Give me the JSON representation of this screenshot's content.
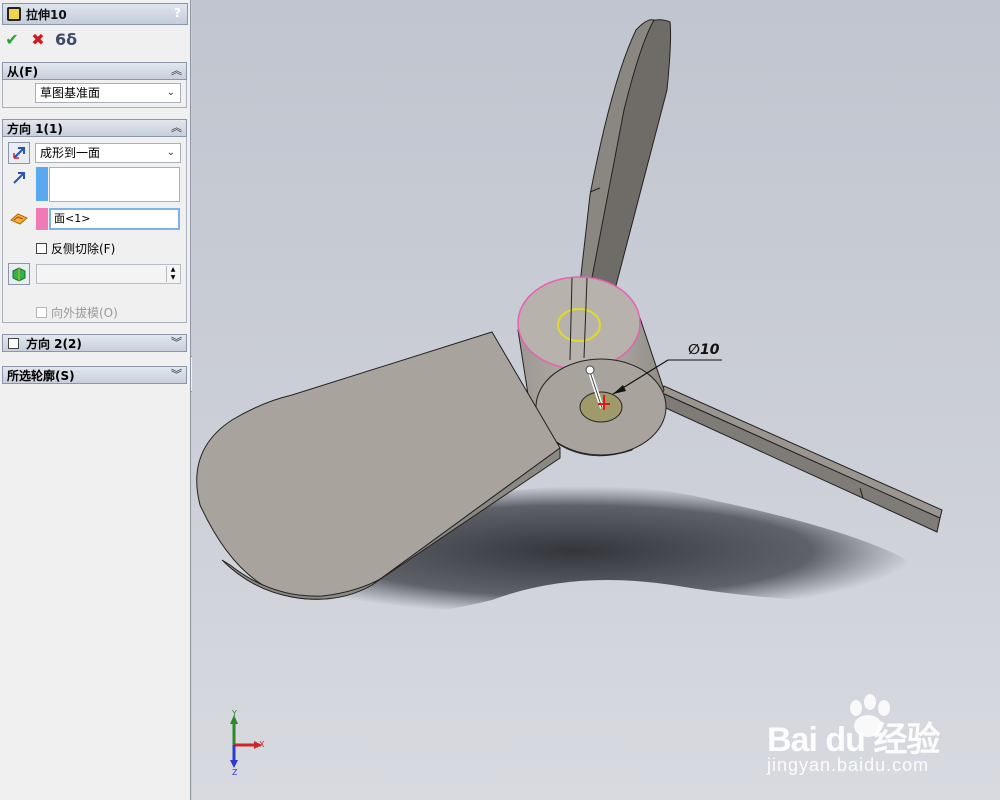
{
  "feature": {
    "title": "拉伸10",
    "help": "?"
  },
  "from": {
    "header": "从(F)",
    "start_condition": "草图基准面"
  },
  "direction1": {
    "header": "方向 1(1)",
    "end_condition": "成形到一面",
    "face_selection": "面<1>",
    "flip_side_label": "反侧切除(F)",
    "draft_outward_label": "向外拔模(O)"
  },
  "direction2": {
    "header": "方向 2(2)"
  },
  "selected_contours": {
    "header": "所选轮廓(S)"
  },
  "viewport": {
    "dimension_label": "∅10",
    "triad": {
      "y": "Y",
      "x": "X",
      "z": "Z"
    },
    "watermark_main": "Bai du 经验",
    "watermark_sub": "jingyan.baidu.com"
  }
}
